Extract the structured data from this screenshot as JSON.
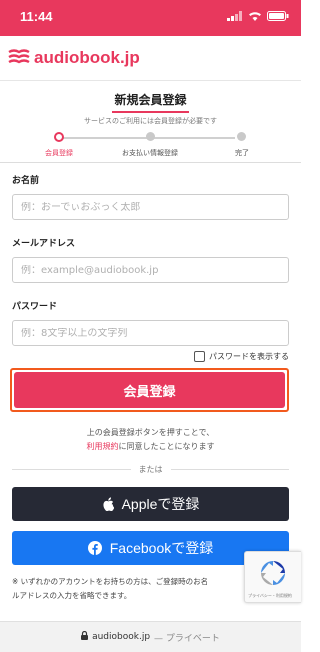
{
  "status_bar": {
    "time": "11:44"
  },
  "header": {
    "logo_text": "audiobook.jp"
  },
  "form": {
    "title": "新規会員登録",
    "subtitle": "サービスのご利用には会員登録が必要です",
    "steps": [
      {
        "label": "会員登録",
        "active": true
      },
      {
        "label": "お支払い情報登録",
        "active": false
      },
      {
        "label": "完了",
        "active": false
      }
    ],
    "name_label": "お名前",
    "name_placeholder": "例：おーでぃおぶっく太郎",
    "email_label": "メールアドレス",
    "email_placeholder": "例：example@audiobook.jp",
    "password_label": "パスワード",
    "password_placeholder": "例：8文字以上の文字列",
    "show_password_label": "パスワードを表示する",
    "submit_label": "会員登録",
    "agree_line1": "上の会員登録ボタンを押すことで、",
    "agree_link": "利用規約",
    "agree_line2_rest": "に同意したことになります",
    "or_text": "または",
    "apple_label": "Appleで登録",
    "facebook_label": "Facebookで登録",
    "note_line1": "※ いずれかのアカウントをお持ちの方は、ご登録時のお名",
    "note_line2": "ルアドレスの入力を省略できます。"
  },
  "recaptcha": {
    "label": "プライバシー・利用規約"
  },
  "url_bar": {
    "domain": "audiobook.jp",
    "mode": "— プライベート"
  },
  "colors": {
    "brand": "#e8385d",
    "apple": "#262935",
    "facebook": "#1877f2",
    "highlight": "#f25a1d"
  }
}
